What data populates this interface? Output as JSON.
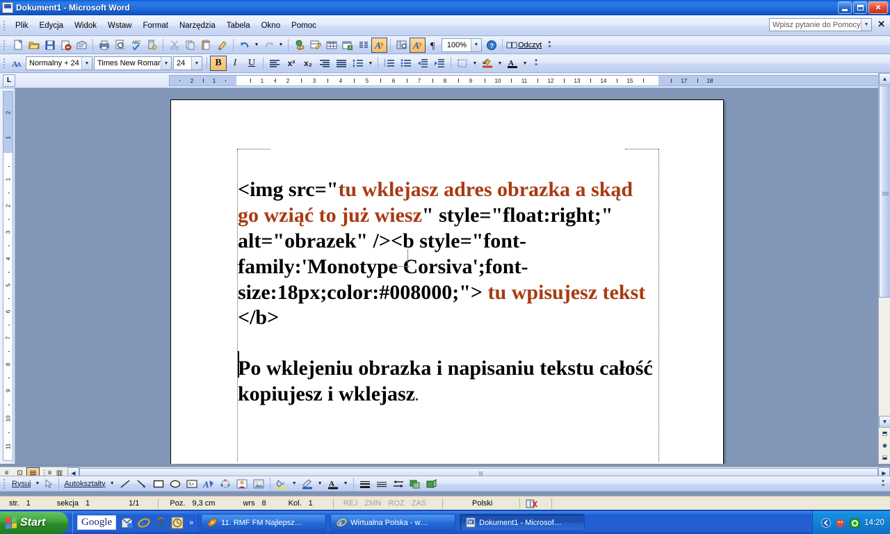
{
  "window": {
    "title": "Dokument1 - Microsoft Word",
    "app_icon": "word-document-icon",
    "minimize_label": "",
    "maximize_label": "",
    "close_label": "✕"
  },
  "menubar": {
    "items": [
      {
        "label": "Plik"
      },
      {
        "label": "Edycja"
      },
      {
        "label": "Widok"
      },
      {
        "label": "Wstaw"
      },
      {
        "label": "Format"
      },
      {
        "label": "Narzędzia"
      },
      {
        "label": "Tabela"
      },
      {
        "label": "Okno"
      },
      {
        "label": "Pomoc"
      }
    ],
    "ask_box": {
      "placeholder": "Wpisz pytanie do Pomocy",
      "value": "Wpisz pytanie do Pomocy"
    },
    "close_label": "✕"
  },
  "standard_toolbar": {
    "buttons": [
      {
        "name": "new-document-icon",
        "title": "Nowy"
      },
      {
        "name": "open-folder-icon",
        "title": "Otwórz"
      },
      {
        "name": "save-icon",
        "title": "Zapisz"
      },
      {
        "name": "mail-recipient-icon",
        "title": "Poczta"
      },
      {
        "name": "print-preview-permission-icon",
        "title": "Uprawnienia"
      },
      {
        "name": "print-icon",
        "title": "Drukuj"
      },
      {
        "name": "print-preview-icon",
        "title": "Podgląd wydruku"
      },
      {
        "name": "spelling-check-icon",
        "title": "Pisownia i gramatyka"
      },
      {
        "name": "research-icon",
        "title": "Badania"
      },
      {
        "name": "cut-scissors-icon",
        "title": "Wytnij"
      },
      {
        "name": "copy-icon",
        "title": "Kopiuj"
      },
      {
        "name": "paste-icon",
        "title": "Wklej"
      },
      {
        "name": "format-painter-icon",
        "title": "Malarz formatów"
      },
      {
        "name": "undo-icon",
        "title": "Cofnij"
      },
      {
        "name": "redo-icon",
        "title": "Ponów"
      },
      {
        "name": "insert-hyperlink-icon",
        "title": "Hiperłącze"
      },
      {
        "name": "tables-and-borders-icon",
        "title": "Tabele i krawędzie"
      },
      {
        "name": "insert-table-icon",
        "title": "Wstaw tabelę"
      },
      {
        "name": "insert-excel-sheet-icon",
        "title": "Arkusz Excel"
      },
      {
        "name": "columns-icon",
        "title": "Kolumny"
      },
      {
        "name": "drawing-icon",
        "title": "Rysowanie"
      },
      {
        "name": "document-map-icon",
        "title": "Mapa dokumentu"
      },
      {
        "name": "show-hide-drawing-icon",
        "title": "Rysowanie"
      },
      {
        "name": "show-formatting-marks-icon",
        "title": "Pokaż wszystko"
      }
    ],
    "zoom": {
      "value": "100%",
      "label": "100%"
    },
    "help_icon": "help-question-icon",
    "read_button": {
      "label": "Odczyt",
      "icon": "read-book-icon"
    }
  },
  "formatting_toolbar": {
    "styles_icon": "styles-and-formatting-icon",
    "style": {
      "value": "Normalny + 24"
    },
    "font": {
      "value": "Times New Roman"
    },
    "size": {
      "value": "24"
    },
    "bold": {
      "label": "B",
      "active": true
    },
    "italic": {
      "label": "I",
      "active": false
    },
    "underline": {
      "label": "U",
      "active": false
    },
    "align_left": {
      "name": "align-left-icon"
    },
    "superscript": {
      "label": "x²"
    },
    "subscript": {
      "label": "x₂"
    },
    "align_right": {
      "name": "align-right-icon"
    },
    "justify": {
      "name": "justify-icon"
    },
    "line_spacing": {
      "name": "line-spacing-icon"
    },
    "numbered_list": {
      "name": "numbered-list-icon"
    },
    "bulleted_list": {
      "name": "bulleted-list-icon"
    },
    "decrease_indent": {
      "name": "decrease-indent-icon"
    },
    "increase_indent": {
      "name": "increase-indent-icon"
    },
    "borders": {
      "name": "borders-icon"
    },
    "highlight": {
      "name": "highlight-color-icon",
      "color": "#f2d61a"
    },
    "font_color": {
      "name": "font-color-icon",
      "color": "#000000"
    }
  },
  "ruler": {
    "tab_selector": "L",
    "horizontal_ticks": [
      "2",
      "1",
      "1",
      "2",
      "3",
      "4",
      "5",
      "6",
      "7",
      "8",
      "9",
      "10",
      "11",
      "12",
      "13",
      "14",
      "15",
      "17",
      "18"
    ],
    "vertical_ticks": [
      "2",
      "1",
      "1",
      "2",
      "3",
      "4",
      "5",
      "6",
      "7",
      "8",
      "9",
      "10",
      "11"
    ]
  },
  "document": {
    "paragraph1": {
      "segments": [
        {
          "text": "<img src=\"",
          "highlight": false
        },
        {
          "text": "tu wklejasz adres obrazka a skąd go wziąć to już wiesz",
          "highlight": true
        },
        {
          "text": "\" style=\"float:right;\" alt=\"obrazek\" /><b style=\"font-family:'Monotype Corsiva';font-size:18px;color:#008000;\"> ",
          "highlight": false
        },
        {
          "text": "tu wpisujesz tekst ",
          "highlight": true
        },
        {
          "text": "</b>",
          "highlight": false
        }
      ]
    },
    "paragraph2": {
      "text": "Po wklejeniu obrazka i napisaniu tekstu całość kopiujesz i wklejasz",
      "trailing": "."
    },
    "highlight_color": "#a93a11"
  },
  "view_buttons": [
    {
      "name": "normal-view-button",
      "label": "≡",
      "active": false
    },
    {
      "name": "web-layout-view-button",
      "label": "⊡",
      "active": false
    },
    {
      "name": "print-layout-view-button",
      "label": "▤",
      "active": true
    },
    {
      "name": "outline-view-button",
      "label": "⋮≡",
      "active": false
    },
    {
      "name": "reading-layout-view-button",
      "label": "▥",
      "active": false
    }
  ],
  "drawing_toolbar": {
    "draw_menu": {
      "label": "Rysuj"
    },
    "select_objects": {
      "name": "select-arrow-icon"
    },
    "autoshapes": {
      "label": "Autokształty"
    },
    "buttons": [
      {
        "name": "line-icon"
      },
      {
        "name": "arrow-icon"
      },
      {
        "name": "rectangle-icon"
      },
      {
        "name": "oval-icon"
      },
      {
        "name": "text-box-icon"
      },
      {
        "name": "wordart-icon"
      },
      {
        "name": "diagram-icon"
      },
      {
        "name": "clip-art-icon"
      },
      {
        "name": "insert-picture-icon"
      },
      {
        "name": "fill-color-icon"
      },
      {
        "name": "line-color-icon"
      },
      {
        "name": "font-color-icon"
      },
      {
        "name": "line-style-icon"
      },
      {
        "name": "dash-style-icon"
      },
      {
        "name": "arrow-style-icon"
      },
      {
        "name": "shadow-style-icon"
      },
      {
        "name": "3d-style-icon"
      }
    ]
  },
  "statusbar": {
    "page_label": "str.",
    "page_value": "1",
    "section_label": "sekcja",
    "section_value": "1",
    "page_of": "1/1",
    "position_label": "Poz.",
    "position_value": "9,3 cm",
    "line_label": "wrs",
    "line_value": "8",
    "col_label": "Kol.",
    "col_value": "1",
    "modes": [
      "REJ",
      "ZMN",
      "ROZ",
      "ZAS"
    ],
    "language": "Polski",
    "spell_icon": "spelling-status-icon"
  },
  "taskbar": {
    "start_label": "Start",
    "quick_launch": [
      {
        "name": "google-toolbar-icon",
        "label": "Google"
      },
      {
        "name": "outlook-express-icon",
        "label": ""
      },
      {
        "name": "internet-explorer-icon",
        "label": ""
      },
      {
        "name": "firefox-icon",
        "label": ""
      },
      {
        "name": "clock-widget-icon",
        "label": ""
      },
      {
        "name": "quick-launch-overflow-icon",
        "label": "»"
      }
    ],
    "tasks": [
      {
        "name": "taskbar-item-winamp",
        "label": "11. RMF FM  Najlepsz…",
        "icon": "winamp-icon",
        "active": false
      },
      {
        "name": "taskbar-item-browser",
        "label": "Wirtualna Polska - w…",
        "icon": "internet-explorer-icon",
        "active": false
      },
      {
        "name": "taskbar-item-word",
        "label": "Dokument1 - Microsof…",
        "icon": "word-document-icon",
        "active": true
      }
    ],
    "tray": {
      "expand_icon": "tray-expand-icon",
      "icons": [
        "antivirus-icon",
        "shield-icon"
      ],
      "clock": "14:20"
    }
  },
  "colors": {
    "titlebar_blue": "#1d6ee0",
    "toolbar_blue": "#d6e1f7",
    "document_bg": "#8296b8",
    "highlight_text": "#a93a11",
    "pressed_orange": "#f7bc63"
  }
}
